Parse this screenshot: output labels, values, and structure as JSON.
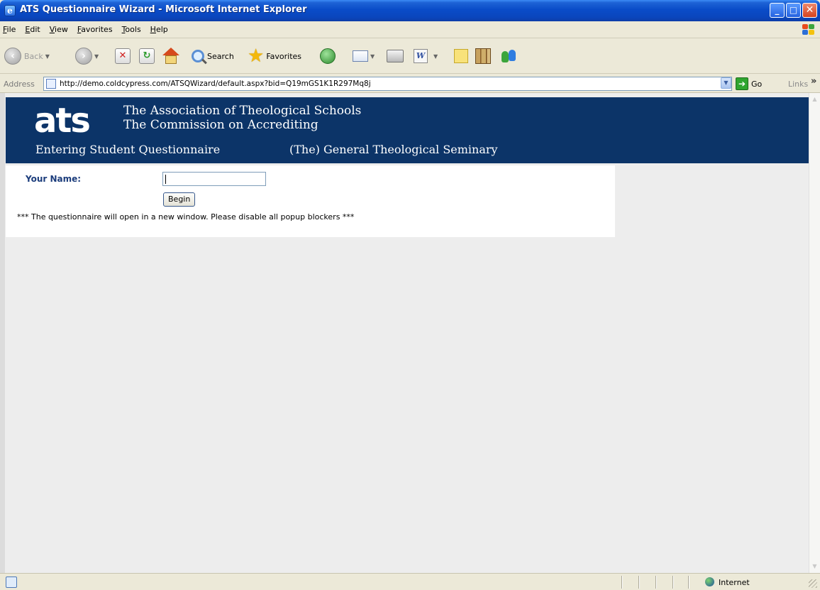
{
  "window": {
    "title": "ATS Questionnaire Wizard - Microsoft Internet Explorer",
    "buttons": {
      "minimize": "_",
      "maximize": "□",
      "close": "✕"
    }
  },
  "menubar": {
    "items": [
      "File",
      "Edit",
      "View",
      "Favorites",
      "Tools",
      "Help"
    ]
  },
  "toolbar": {
    "back_label": "Back",
    "search_label": "Search",
    "favorites_label": "Favorites",
    "icons": [
      "back-icon",
      "forward-icon",
      "stop-icon",
      "refresh-icon",
      "home-icon",
      "search-icon",
      "favorites-icon",
      "history-icon",
      "mail-icon",
      "print-icon",
      "word-icon",
      "notes-icon",
      "research-icon",
      "messenger-icon"
    ]
  },
  "addressbar": {
    "label": "Address",
    "url": "http://demo.coldcypress.com/ATSQWizard/default.aspx?bid=Q19mGS1K1R297Mq8j",
    "go_label": "Go",
    "links_label": "Links",
    "more_label": "»"
  },
  "banner": {
    "logo": "ats",
    "line1": "The Association of Theological Schools",
    "line2": "The Commission on Accrediting",
    "subtitle": "Entering Student Questionnaire",
    "seminary": "(The) General Theological Seminary"
  },
  "form": {
    "name_label": "Your Name:",
    "name_value": "",
    "begin_label": "Begin",
    "notice": "*** The questionnaire will open in a new window. Please disable all popup blockers ***"
  },
  "statusbar": {
    "zone": "Internet"
  },
  "colors": {
    "banner": "#0c3468",
    "label": "#1c3d7c",
    "titlebar": "#0a4cc8"
  }
}
